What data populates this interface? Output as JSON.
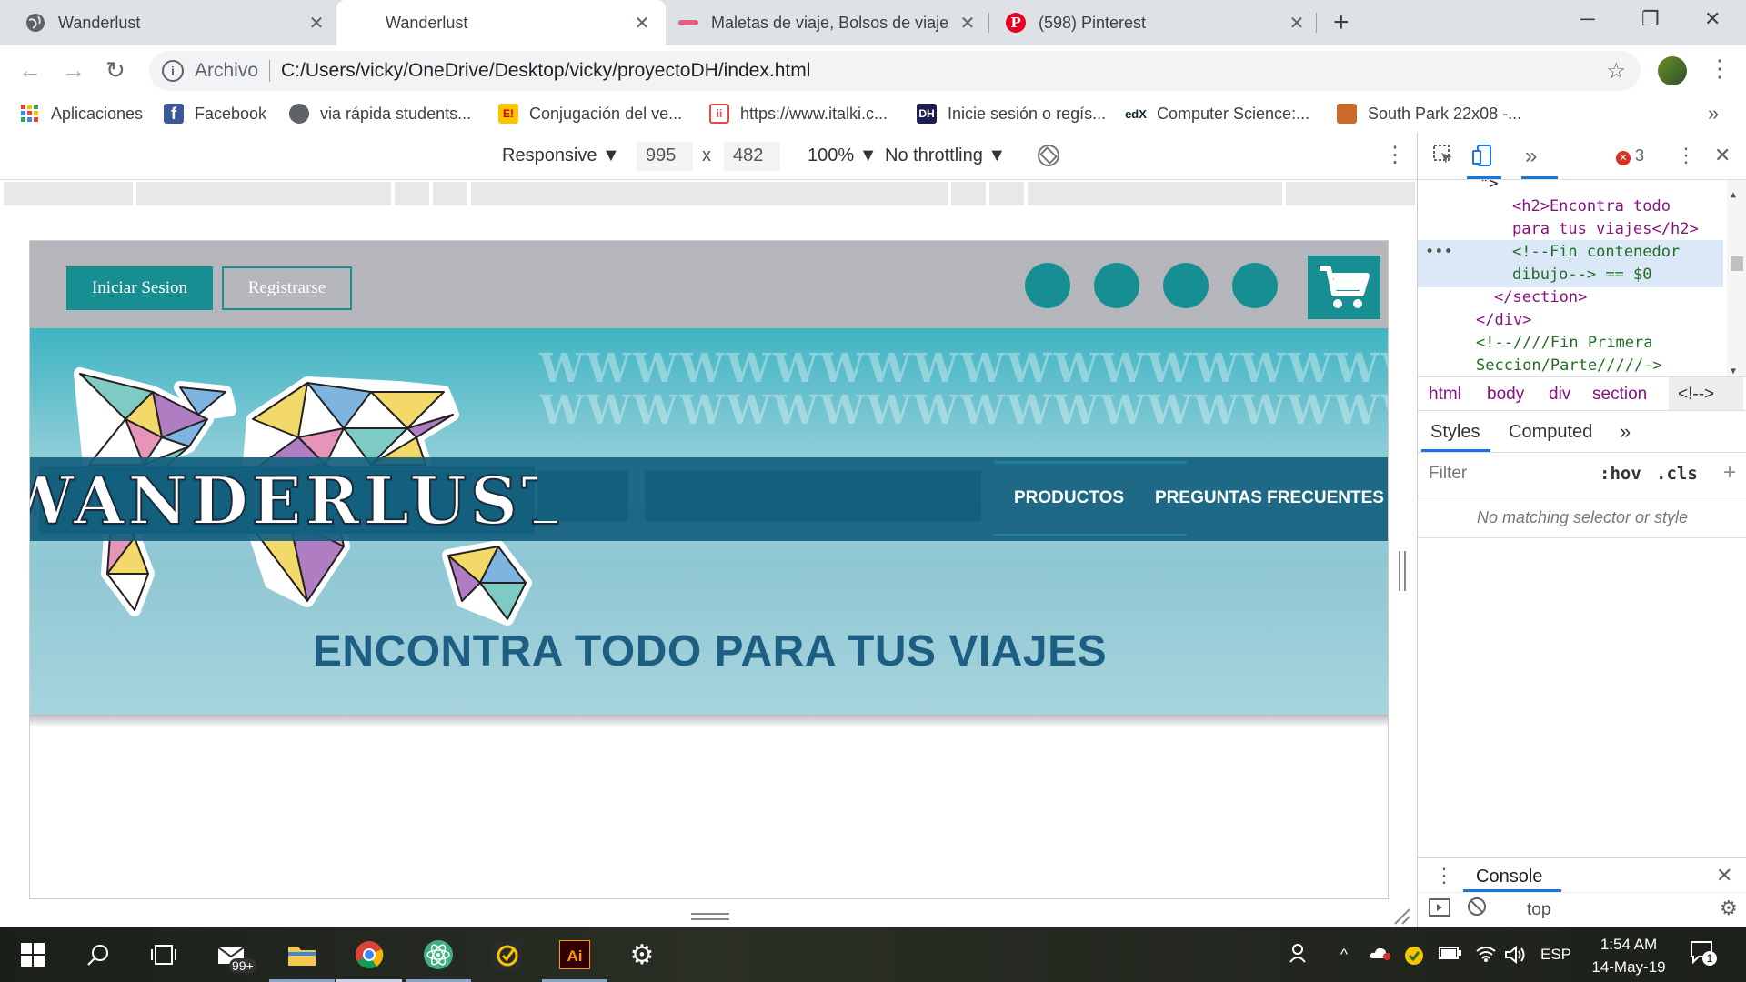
{
  "browser": {
    "tabs": [
      {
        "title": "Wanderlust",
        "icon": "globe-icon",
        "active": false
      },
      {
        "title": "Wanderlust",
        "icon": "none",
        "active": true
      },
      {
        "title": "Maletas de viaje, Bolsos de viaje",
        "icon": "suitcase-icon",
        "active": false
      },
      {
        "title": "(598) Pinterest",
        "icon": "pinterest-icon",
        "active": false
      }
    ],
    "new_tab": "+",
    "window_controls": {
      "minimize": "─",
      "restore": "❐",
      "close": "✕"
    },
    "nav": {
      "back": "←",
      "forward": "→",
      "reload": "↻"
    },
    "omnibox": {
      "security_label": "Archivo",
      "url": "C:/Users/vicky/OneDrive/Desktop/vicky/proyectoDH/index.html",
      "star": "☆"
    },
    "menu": "⋮",
    "bookmarks": [
      {
        "label": "Aplicaciones",
        "icon": "apps-grid-icon"
      },
      {
        "label": "Facebook",
        "icon": "facebook-icon"
      },
      {
        "label": "via rápida students...",
        "icon": "globe-icon"
      },
      {
        "label": "Conjugación del ve...",
        "icon": "conjugacion-icon"
      },
      {
        "label": "https://www.italki.c...",
        "icon": "italki-icon"
      },
      {
        "label": "Inicie sesión o regís...",
        "icon": "dh-icon"
      },
      {
        "label": "Computer Science:...",
        "icon": "edx-icon"
      },
      {
        "label": "South Park 22x08 -...",
        "icon": "southpark-icon"
      }
    ],
    "bookmarks_more": "»"
  },
  "device_toolbar": {
    "mode": "Responsive ▼",
    "width": "995",
    "times": "x",
    "height": "482",
    "zoom": "100% ▼",
    "throttling": "No throttling ▼",
    "more": "⋮"
  },
  "page": {
    "login_button": "Iniciar Sesion",
    "register_button": "Registrarse",
    "social_count": 4,
    "logo": "WANDERLUST",
    "watermark": "WWWWWWWWWWWWWWWWWWWWWWWWWWWWWWWW",
    "nav_links": [
      "PRODUCTOS",
      "PREGUNTAS FRECUENTES"
    ],
    "hero_title": "ENCONTRA TODO PARA TUS VIAJES",
    "colors": {
      "teal": "#178f92",
      "navy": "#12607e",
      "title": "#1d5f82",
      "header": "#b5b6bc"
    }
  },
  "devtools": {
    "error_count": "3",
    "more_tabs": "»",
    "elements": [
      {
        "text": "\">",
        "kind": "txt"
      },
      {
        "text": "<h2>Encontra todo",
        "kind": "tag"
      },
      {
        "text": "para tus viajes</h2>",
        "kind": "tag"
      },
      {
        "text": "<!--Fin contenedor",
        "kind": "comment"
      },
      {
        "text": "dibujo--> == $0",
        "kind": "comment"
      },
      {
        "text": "</section>",
        "kind": "tag"
      },
      {
        "text": "</div>",
        "kind": "tag"
      },
      {
        "text": "<!--////Fin Primera",
        "kind": "comment"
      },
      {
        "text": "Seccion/Parte/////->",
        "kind": "comment"
      }
    ],
    "breadcrumbs": [
      "html",
      "body",
      "div",
      "section",
      "<!-->"
    ],
    "styles_tabs": [
      "Styles",
      "Computed",
      "»"
    ],
    "filter_placeholder": "Filter",
    "hov": ":hov",
    "cls": ".cls",
    "add": "+",
    "no_match": "No matching selector or style",
    "console_label": "Console",
    "console_context": "top"
  },
  "taskbar": {
    "badge": "99+",
    "language": "ESP",
    "time": "1:54 AM",
    "date": "14-May-19",
    "notifications": "1"
  }
}
